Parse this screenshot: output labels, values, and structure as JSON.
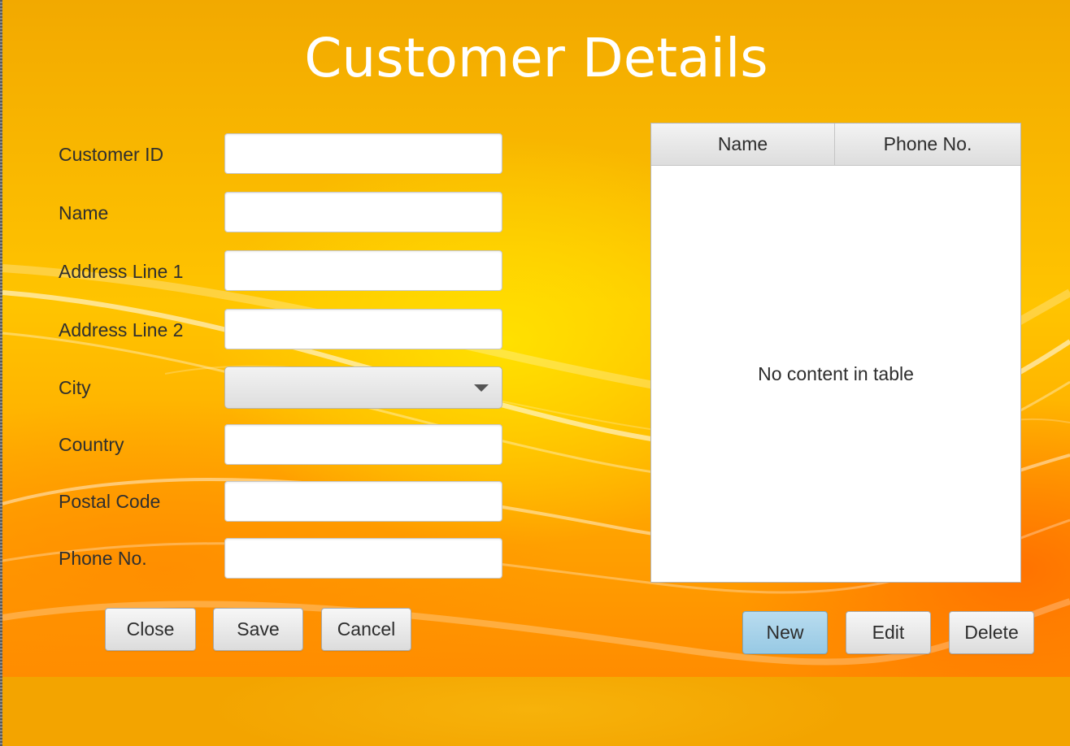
{
  "window": {
    "title": "Customer Details"
  },
  "form": {
    "customer_id": {
      "label": "Customer ID",
      "value": "",
      "placeholder": ""
    },
    "name": {
      "label": "Name",
      "value": "",
      "placeholder": ""
    },
    "address_line_1": {
      "label": "Address Line 1",
      "value": "",
      "placeholder": ""
    },
    "address_line_2": {
      "label": "Address Line 2",
      "value": "",
      "placeholder": ""
    },
    "city": {
      "label": "City",
      "selected": ""
    },
    "country": {
      "label": "Country",
      "value": "",
      "placeholder": ""
    },
    "postal_code": {
      "label": "Postal Code",
      "value": "",
      "placeholder": ""
    },
    "phone_no": {
      "label": "Phone No.",
      "value": "",
      "placeholder": ""
    }
  },
  "form_buttons": {
    "close": "Close",
    "save": "Save",
    "cancel": "Cancel"
  },
  "table": {
    "columns": [
      "Name",
      "Phone No."
    ],
    "rows": [],
    "placeholder": "No content in table"
  },
  "table_buttons": {
    "new": "New",
    "edit": "Edit",
    "delete": "Delete"
  },
  "colors": {
    "background_top": "#f2a900",
    "background_center": "#ffd200",
    "background_bottom": "#ff8c00",
    "title_text": "#ffffff",
    "default_button": "#a6d1e8"
  },
  "icons": {
    "combo_arrow": "chevron-down-icon"
  }
}
